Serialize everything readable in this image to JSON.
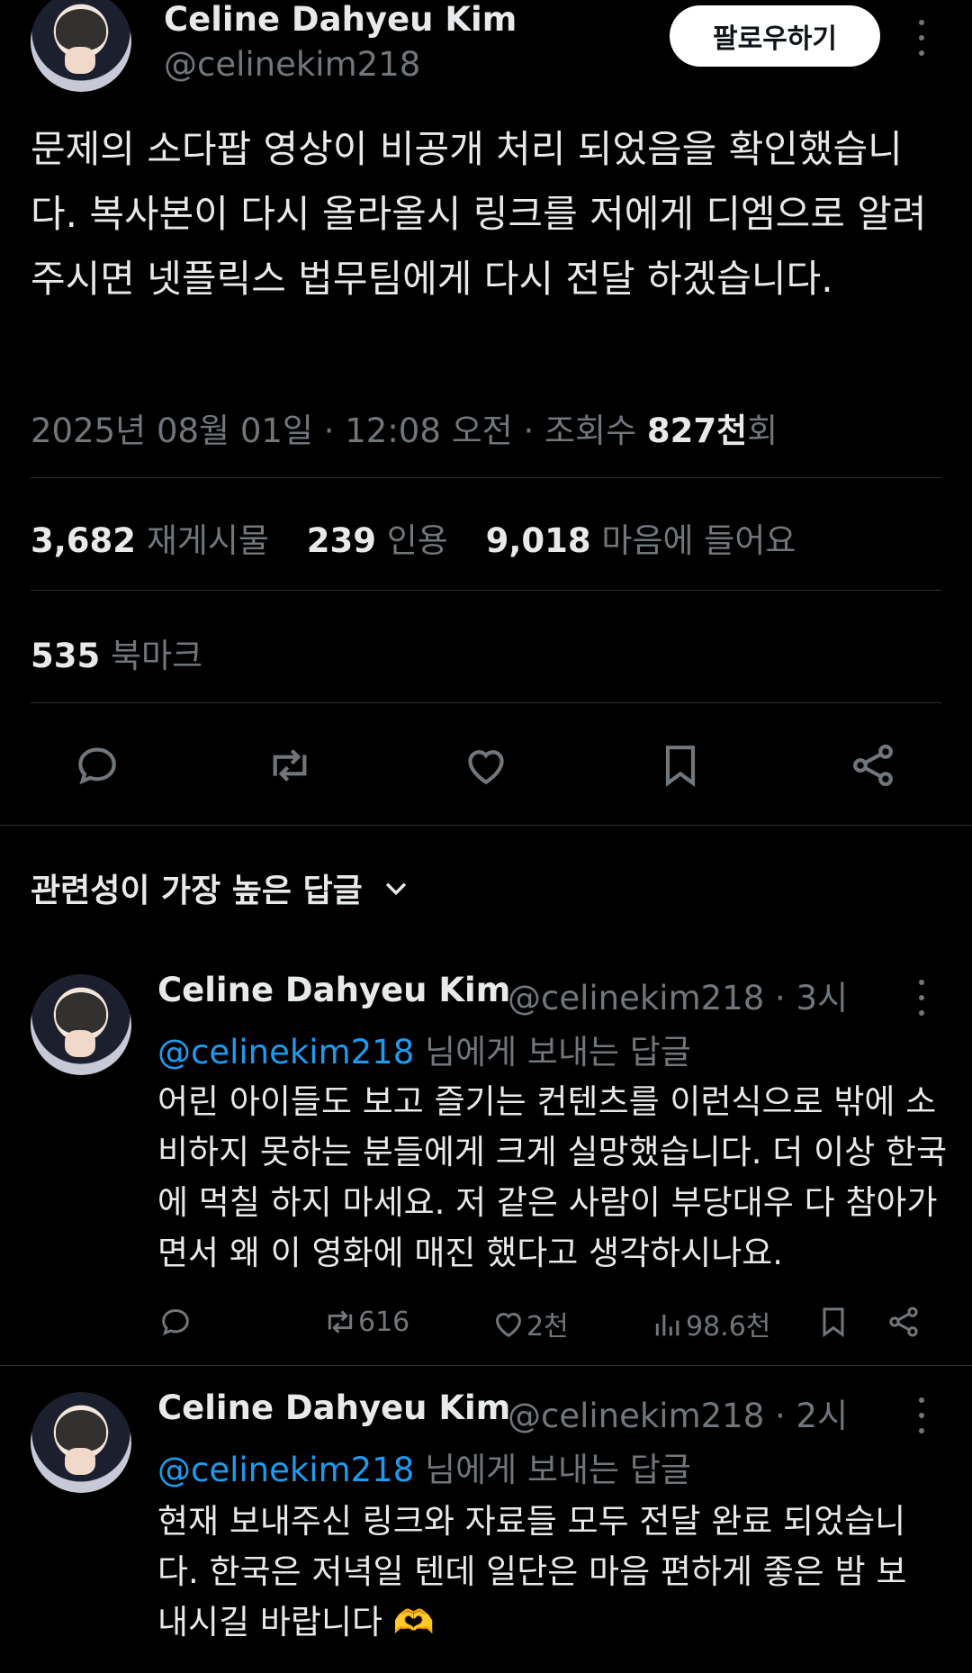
{
  "tweet": {
    "author_name": "Celine Dahyeu Kim",
    "author_handle": "@celinekim218",
    "follow_label": "팔로우하기",
    "text": "문제의 소다팝 영상이 비공개 처리 되었음을 확인했습니다. 복사본이 다시 올라올시 링크를 저에게 디엠으로 알려주시면 넷플릭스 법무팀에게 다시 전달 하겠습니다.",
    "timestamp": "2025년 08월 01일 · 12:08 오전 · 조회수",
    "views": "827천",
    "views_suffix": "회",
    "retweets_count": "3,682",
    "retweets_label": "재게시물",
    "quotes_count": "239",
    "quotes_label": "인용",
    "likes_count": "9,018",
    "likes_label": "마음에 들어요",
    "bookmarks_count": "535",
    "bookmarks_label": "북마크"
  },
  "actions": [
    "reply-icon",
    "retweet-icon",
    "heart-icon",
    "bookmark-icon",
    "share-icon"
  ],
  "replies_sort": {
    "label": "관련성이 가장 높은 답글"
  },
  "replies": [
    {
      "author_name": "Celine Dahyeu Kim",
      "author_handle": "@celinekim218 · 3시",
      "reply_to_mention": "@celinekim218",
      "reply_to_suffix": "님에게 보내는 답글",
      "text": "어린 아이들도 보고 즐기는 컨텐츠를 이런식으로 밖에 소비하지 못하는 분들에게 크게 실망했습니다. 더 이상 한국에 먹칠 하지 마세요. 저 같은 사람이 부당대우 다 참아가면서 왜 이 영화에 매진 했다고 생각하시나요.",
      "retweets": "616",
      "likes": "2천",
      "views": "98.6천"
    },
    {
      "author_name": "Celine Dahyeu Kim",
      "author_handle": "@celinekim218 · 2시",
      "reply_to_mention": "@celinekim218",
      "reply_to_suffix": "님에게 보내는 답글",
      "text": "현재 보내주신 링크와 자료들 모두 전달 완료 되었습니다. 한국은 저녁일 텐데 일단은 마음 편하게 좋은 밤 보내시길 바랍니다 🫶"
    }
  ],
  "colors": {
    "background": "#000000",
    "text": "#e7e9ea",
    "muted": "#71767b",
    "link": "#1d9bf0",
    "divider": "#2f3336"
  }
}
